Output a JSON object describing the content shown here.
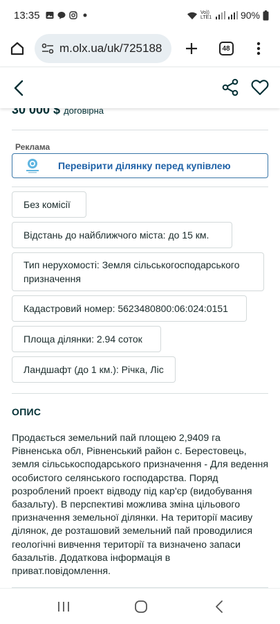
{
  "status": {
    "time": "13:35",
    "battery": "90%",
    "net": "Vo)) LTE1"
  },
  "browser": {
    "url": "m.olx.ua/uk/725188",
    "tab_count": "48"
  },
  "listing": {
    "price": "30 000 $",
    "negotiable": "договірна",
    "ad_label": "Реклама",
    "ad_button": "Перевірити ділянку перед купівлею",
    "tags": [
      "Без комісії",
      "Відстань до найближчого міста: до 15 км.",
      "Тип нерухомості: Земля сільськогосподарського призначення",
      "Кадастровий номер: 5623480800:06:024:0151",
      "Площа ділянки: 2.94 соток",
      "Ландшафт (до 1 км.): Річка, Ліс"
    ],
    "description_title": "ОПИС",
    "description": "Продається земельний пай площею 2,9409 га Рівненська обл, Рівненський район с. Берестовець, земля сільськоспод­арського призначення - Для ведення особистого селянського господарства. Поряд розроблений проект відводу під кар'єр (видобування базальту). В перспективі можлива зміна цільового призначення земельної ділянки. На території масиву ділянок, де розташовий земельний пай проводилися геологічні вивчення території та визначено запаси базальтів. Додаткова інформація в приват.повідомлення."
  },
  "colors": {
    "text": "#002f34",
    "ad_blue": "#1f62a7",
    "border": "#d3d9da"
  }
}
